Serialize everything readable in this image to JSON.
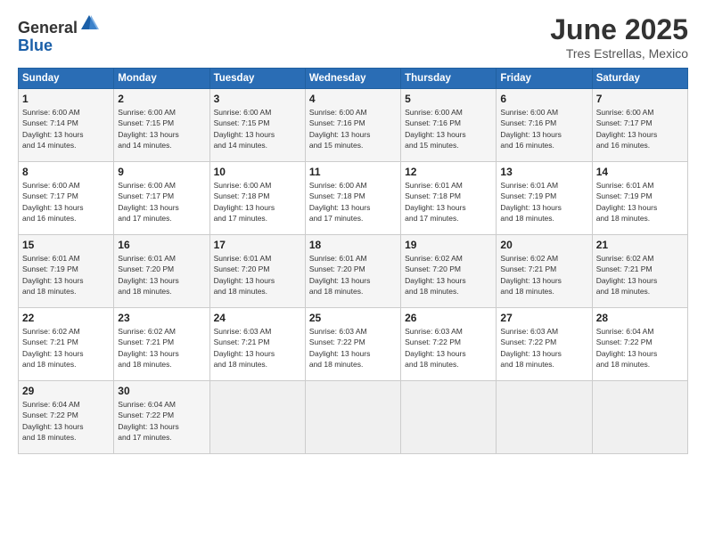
{
  "header": {
    "logo_line1": "General",
    "logo_line2": "Blue",
    "main_title": "June 2025",
    "subtitle": "Tres Estrellas, Mexico"
  },
  "days_of_week": [
    "Sunday",
    "Monday",
    "Tuesday",
    "Wednesday",
    "Thursday",
    "Friday",
    "Saturday"
  ],
  "weeks": [
    [
      {
        "day": 1,
        "sunrise": "6:00 AM",
        "sunset": "7:14 PM",
        "daylight": "13 hours and 14 minutes."
      },
      {
        "day": 2,
        "sunrise": "6:00 AM",
        "sunset": "7:15 PM",
        "daylight": "13 hours and 14 minutes."
      },
      {
        "day": 3,
        "sunrise": "6:00 AM",
        "sunset": "7:15 PM",
        "daylight": "13 hours and 14 minutes."
      },
      {
        "day": 4,
        "sunrise": "6:00 AM",
        "sunset": "7:16 PM",
        "daylight": "13 hours and 15 minutes."
      },
      {
        "day": 5,
        "sunrise": "6:00 AM",
        "sunset": "7:16 PM",
        "daylight": "13 hours and 15 minutes."
      },
      {
        "day": 6,
        "sunrise": "6:00 AM",
        "sunset": "7:16 PM",
        "daylight": "13 hours and 16 minutes."
      },
      {
        "day": 7,
        "sunrise": "6:00 AM",
        "sunset": "7:17 PM",
        "daylight": "13 hours and 16 minutes."
      }
    ],
    [
      {
        "day": 8,
        "sunrise": "6:00 AM",
        "sunset": "7:17 PM",
        "daylight": "13 hours and 16 minutes."
      },
      {
        "day": 9,
        "sunrise": "6:00 AM",
        "sunset": "7:17 PM",
        "daylight": "13 hours and 17 minutes."
      },
      {
        "day": 10,
        "sunrise": "6:00 AM",
        "sunset": "7:18 PM",
        "daylight": "13 hours and 17 minutes."
      },
      {
        "day": 11,
        "sunrise": "6:00 AM",
        "sunset": "7:18 PM",
        "daylight": "13 hours and 17 minutes."
      },
      {
        "day": 12,
        "sunrise": "6:01 AM",
        "sunset": "7:18 PM",
        "daylight": "13 hours and 17 minutes."
      },
      {
        "day": 13,
        "sunrise": "6:01 AM",
        "sunset": "7:19 PM",
        "daylight": "13 hours and 18 minutes."
      },
      {
        "day": 14,
        "sunrise": "6:01 AM",
        "sunset": "7:19 PM",
        "daylight": "13 hours and 18 minutes."
      }
    ],
    [
      {
        "day": 15,
        "sunrise": "6:01 AM",
        "sunset": "7:19 PM",
        "daylight": "13 hours and 18 minutes."
      },
      {
        "day": 16,
        "sunrise": "6:01 AM",
        "sunset": "7:20 PM",
        "daylight": "13 hours and 18 minutes."
      },
      {
        "day": 17,
        "sunrise": "6:01 AM",
        "sunset": "7:20 PM",
        "daylight": "13 hours and 18 minutes."
      },
      {
        "day": 18,
        "sunrise": "6:01 AM",
        "sunset": "7:20 PM",
        "daylight": "13 hours and 18 minutes."
      },
      {
        "day": 19,
        "sunrise": "6:02 AM",
        "sunset": "7:20 PM",
        "daylight": "13 hours and 18 minutes."
      },
      {
        "day": 20,
        "sunrise": "6:02 AM",
        "sunset": "7:21 PM",
        "daylight": "13 hours and 18 minutes."
      },
      {
        "day": 21,
        "sunrise": "6:02 AM",
        "sunset": "7:21 PM",
        "daylight": "13 hours and 18 minutes."
      }
    ],
    [
      {
        "day": 22,
        "sunrise": "6:02 AM",
        "sunset": "7:21 PM",
        "daylight": "13 hours and 18 minutes."
      },
      {
        "day": 23,
        "sunrise": "6:02 AM",
        "sunset": "7:21 PM",
        "daylight": "13 hours and 18 minutes."
      },
      {
        "day": 24,
        "sunrise": "6:03 AM",
        "sunset": "7:21 PM",
        "daylight": "13 hours and 18 minutes."
      },
      {
        "day": 25,
        "sunrise": "6:03 AM",
        "sunset": "7:22 PM",
        "daylight": "13 hours and 18 minutes."
      },
      {
        "day": 26,
        "sunrise": "6:03 AM",
        "sunset": "7:22 PM",
        "daylight": "13 hours and 18 minutes."
      },
      {
        "day": 27,
        "sunrise": "6:03 AM",
        "sunset": "7:22 PM",
        "daylight": "13 hours and 18 minutes."
      },
      {
        "day": 28,
        "sunrise": "6:04 AM",
        "sunset": "7:22 PM",
        "daylight": "13 hours and 18 minutes."
      }
    ],
    [
      {
        "day": 29,
        "sunrise": "6:04 AM",
        "sunset": "7:22 PM",
        "daylight": "13 hours and 18 minutes."
      },
      {
        "day": 30,
        "sunrise": "6:04 AM",
        "sunset": "7:22 PM",
        "daylight": "13 hours and 17 minutes."
      },
      null,
      null,
      null,
      null,
      null
    ]
  ],
  "labels": {
    "sunrise": "Sunrise:",
    "sunset": "Sunset:",
    "daylight": "Daylight:"
  }
}
